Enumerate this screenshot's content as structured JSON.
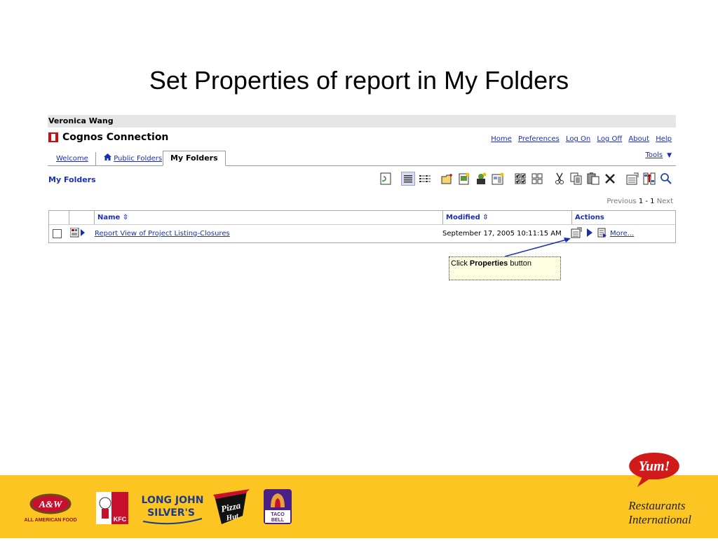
{
  "slide": {
    "title": "Set Properties of report in My Folders"
  },
  "app": {
    "user_name": "Veronica Wang",
    "app_title": "Cognos Connection",
    "top_links": [
      "Home",
      "Preferences",
      "Log On",
      "Log Off",
      "About",
      "Help"
    ],
    "tabs": [
      {
        "label": "Welcome",
        "active": false
      },
      {
        "label": "Public Folders",
        "active": false,
        "icon": "home-icon"
      },
      {
        "label": "My Folders",
        "active": true
      }
    ],
    "tools_label": "Tools",
    "folder_title": "My Folders",
    "toolbar_icons": [
      "refresh-icon",
      "details-view-icon",
      "list-view-icon",
      "new-folder-icon",
      "new-report-icon",
      "new-job-icon",
      "new-page-icon",
      "select-all-icon",
      "deselect-all-icon",
      "cut-icon",
      "copy-icon",
      "paste-icon",
      "delete-icon",
      "set-properties-icon",
      "order-icon",
      "search-icon"
    ],
    "pager": {
      "previous": "Previous",
      "range": "1 - 1",
      "next": "Next"
    },
    "list": {
      "columns": {
        "name": "Name",
        "modified": "Modified",
        "actions": "Actions"
      },
      "rows": [
        {
          "name": "Report View of Project Listing-Closures",
          "modified": "September 17, 2005 10:11:15 AM",
          "more_label": "More..."
        }
      ]
    }
  },
  "callout": {
    "prefix": "Click ",
    "bold": "Properties",
    "suffix": " button"
  },
  "footer": {
    "brands": [
      "A&W All American Food",
      "KFC",
      "Long John Silver's",
      "Pizza Hut",
      "Taco Bell"
    ],
    "yum_logo": "Yum!",
    "yum_line1": "Restaurants",
    "yum_line2": "International",
    "colors": {
      "band": "#fcc522",
      "yum_red": "#d01a1a"
    }
  }
}
